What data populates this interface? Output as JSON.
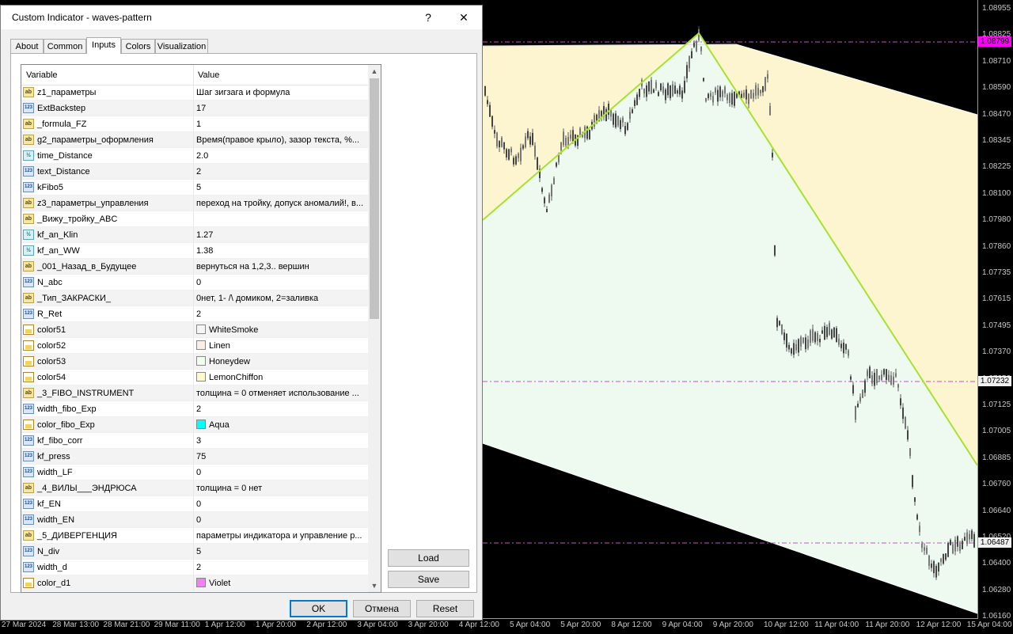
{
  "dialog": {
    "title": "Custom Indicator - waves-pattern",
    "help_label": "?",
    "close_label": "✕",
    "tabs": [
      {
        "label": "About"
      },
      {
        "label": "Common"
      },
      {
        "label": "Inputs"
      },
      {
        "label": "Colors"
      },
      {
        "label": "Visualization"
      }
    ],
    "active_tab": "Inputs",
    "grid": {
      "col_variable": "Variable",
      "col_value": "Value",
      "rows": [
        {
          "type": "ab",
          "name": "z1_параметры",
          "value": "Шаг зигзага и формула"
        },
        {
          "type": "123",
          "name": "ExtBackstep",
          "value": "17"
        },
        {
          "type": "ab",
          "name": "_formula_FZ",
          "value": "1"
        },
        {
          "type": "ab",
          "name": "g2_параметры_оформления",
          "value": "Время(правое крыло), зазор текста, %..."
        },
        {
          "type": "dbl",
          "name": "time_Distance",
          "value": "2.0"
        },
        {
          "type": "123",
          "name": "text_Distance",
          "value": "2"
        },
        {
          "type": "123",
          "name": "kFibo5",
          "value": "5"
        },
        {
          "type": "ab",
          "name": "z3_параметры_управления",
          "value": "переход на тройку, допуск аномалий!, в..."
        },
        {
          "type": "ab",
          "name": "_Вижу_тройку_ABC",
          "value": ""
        },
        {
          "type": "dbl",
          "name": "kf_an_Klin",
          "value": "1.27"
        },
        {
          "type": "dbl",
          "name": "kf_an_WW",
          "value": "1.38"
        },
        {
          "type": "ab",
          "name": "_001_Назад_в_Будущее",
          "value": " вернуться на 1,2,3.. вершин"
        },
        {
          "type": "123",
          "name": "N_abc",
          "value": "0"
        },
        {
          "type": "ab",
          "name": "_Тип_ЗАКРАСКИ_",
          "value": "0нет, 1- /\\ домиком, 2=заливка"
        },
        {
          "type": "123",
          "name": "R_Ret",
          "value": "2"
        },
        {
          "type": "clr",
          "name": "color51",
          "value": "WhiteSmoke",
          "swatch": "#f5f5f5"
        },
        {
          "type": "clr",
          "name": "color52",
          "value": "Linen",
          "swatch": "#faf0e6"
        },
        {
          "type": "clr",
          "name": "color53",
          "value": "Honeydew",
          "swatch": "#f0fff0"
        },
        {
          "type": "clr",
          "name": "color54",
          "value": "LemonChiffon",
          "swatch": "#fffacd"
        },
        {
          "type": "ab",
          "name": "_3_FIBO_INSTRUMENT",
          "value": "толщина = 0  отменяет использование ..."
        },
        {
          "type": "123",
          "name": "width_fibo_Exp",
          "value": "2"
        },
        {
          "type": "clr",
          "name": "color_fibo_Exp",
          "value": "Aqua",
          "swatch": "#00ffff"
        },
        {
          "type": "123",
          "name": "kf_fibo_corr",
          "value": "3"
        },
        {
          "type": "123",
          "name": "kf_press",
          "value": "75"
        },
        {
          "type": "123",
          "name": "width_LF",
          "value": "0"
        },
        {
          "type": "ab",
          "name": "_4_ВИЛЫ___ЭНДРЮСА",
          "value": "толщина = 0  нет"
        },
        {
          "type": "123",
          "name": "kf_EN",
          "value": "0"
        },
        {
          "type": "123",
          "name": "width_EN",
          "value": "0"
        },
        {
          "type": "ab",
          "name": "_5_ДИВЕРГЕНЦИЯ",
          "value": "параметры индикатора и управление р..."
        },
        {
          "type": "123",
          "name": "N_div",
          "value": "5"
        },
        {
          "type": "123",
          "name": "width_d",
          "value": "2"
        },
        {
          "type": "clr",
          "name": "color_d1",
          "value": "Violet",
          "swatch": "#ee82ee"
        }
      ]
    },
    "side_buttons": {
      "load": "Load",
      "save": "Save"
    },
    "footer_buttons": {
      "ok": "OK",
      "cancel": "Отмена",
      "reset": "Reset"
    }
  },
  "chart": {
    "price_ticks": [
      "1.08955",
      "1.08825",
      "1.08710",
      "1.08590",
      "1.08470",
      "1.08345",
      "1.08225",
      "1.08100",
      "1.07980",
      "1.07860",
      "1.07735",
      "1.07615",
      "1.07495",
      "1.07370",
      "1.07250",
      "1.07125",
      "1.07005",
      "1.06885",
      "1.06760",
      "1.06640",
      "1.06520",
      "1.06400",
      "1.06280",
      "1.06160"
    ],
    "badges": [
      {
        "text": "1.08799",
        "color": "#ff00ff"
      },
      {
        "text": "1.07232",
        "color": "#f0f0f0"
      },
      {
        "text": "1.06487",
        "color": "#f0f0f0"
      }
    ],
    "time_ticks": [
      "27 Mar 2024",
      "28 Mar 13:00",
      "28 Mar 21:00",
      "29 Mar 11:00",
      "1 Apr 12:00",
      "1 Apr 20:00",
      "2 Apr 12:00",
      "3 Apr 04:00",
      "3 Apr 20:00",
      "4 Apr 12:00",
      "5 Apr 04:00",
      "5 Apr 20:00",
      "8 Apr 12:00",
      "9 Apr 04:00",
      "9 Apr 20:00",
      "10 Apr 12:00",
      "11 Apr 04:00",
      "11 Apr 20:00",
      "12 Apr 12:00",
      "15 Apr 04:00"
    ],
    "colors": {
      "zigzag": "#a6e22e",
      "fill_upper": "#fdf5d0",
      "fill_lower": "#eefaf0",
      "dashed": "#c850c8"
    }
  }
}
